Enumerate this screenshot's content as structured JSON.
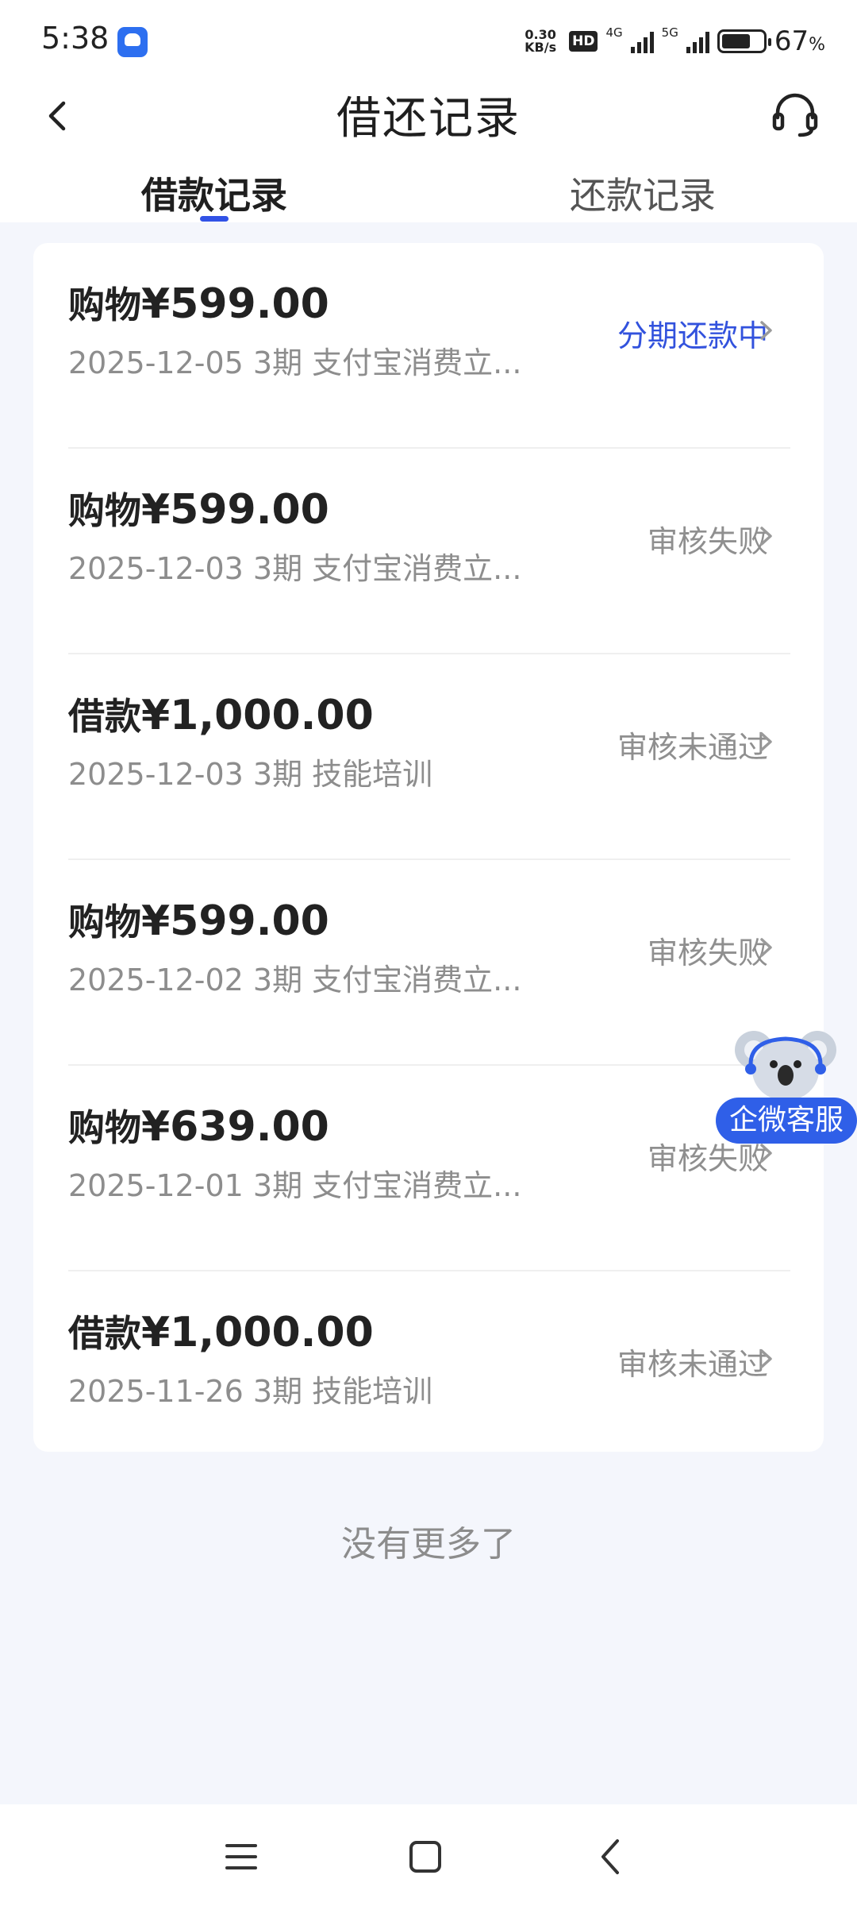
{
  "status_bar": {
    "time": "5:38",
    "net_speed_value": "0.30",
    "net_speed_unit": "KB/s",
    "hd_badge": "HD",
    "gen_1": "4G",
    "gen_2": "5G",
    "battery_percent": "67",
    "battery_unit": "%"
  },
  "header": {
    "title": "借还记录"
  },
  "tabs": [
    {
      "label": "借款记录",
      "active": true
    },
    {
      "label": "还款记录",
      "active": false
    }
  ],
  "records": [
    {
      "type": "购物",
      "amount": "¥599.00",
      "subtitle": "2025-12-05 3期  支付宝消费立...",
      "status": "分期还款中",
      "status_active": true
    },
    {
      "type": "购物",
      "amount": "¥599.00",
      "subtitle": "2025-12-03 3期  支付宝消费立...",
      "status": "审核失败",
      "status_active": false
    },
    {
      "type": "借款",
      "amount": "¥1,000.00",
      "subtitle": "2025-12-03 3期  技能培训",
      "status": "审核未通过",
      "status_active": false
    },
    {
      "type": "购物",
      "amount": "¥599.00",
      "subtitle": "2025-12-02 3期  支付宝消费立...",
      "status": "审核失败",
      "status_active": false
    },
    {
      "type": "购物",
      "amount": "¥639.00",
      "subtitle": "2025-12-01 3期  支付宝消费立...",
      "status": "审核失败",
      "status_active": false
    },
    {
      "type": "借款",
      "amount": "¥1,000.00",
      "subtitle": "2025-11-26 3期  技能培训",
      "status": "审核未通过",
      "status_active": false
    }
  ],
  "footer": {
    "no_more": "没有更多了"
  },
  "float_service": {
    "label": "企微客服"
  },
  "colors": {
    "accent": "#3152e6",
    "status_active": "#3252dd",
    "status_muted": "#8f8f8f",
    "background": "#f4f6fc"
  },
  "icons": {
    "back": "chevron-left-icon",
    "service": "headset-icon",
    "row_arrow": "chevron-right-icon",
    "mascot": "koala-icon",
    "nav_menu": "menu-icon",
    "nav_home": "square-icon",
    "nav_back": "chevron-left-icon"
  }
}
